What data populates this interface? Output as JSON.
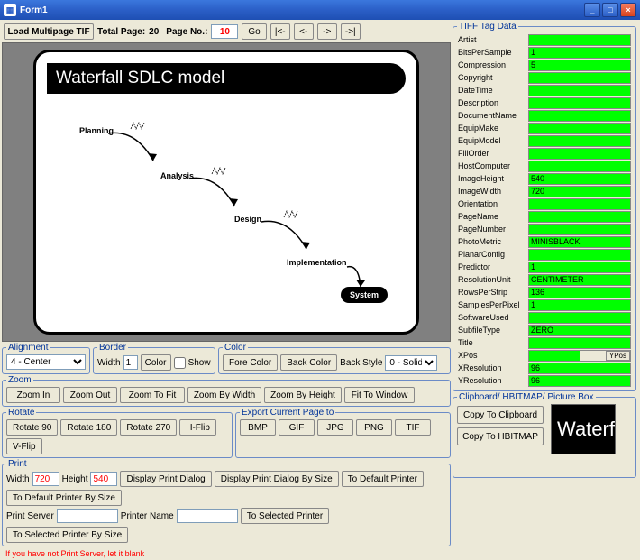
{
  "window": {
    "title": "Form1"
  },
  "toolbar": {
    "loadBtn": "Load Multipage TIF",
    "totalLabel": "Total Page:",
    "totalValue": "20",
    "pageNoLabel": "Page No.:",
    "pageNoValue": "10",
    "goBtn": "Go",
    "first": "|<-",
    "prev": "<-",
    "next": "->",
    "last": "->|"
  },
  "slide": {
    "title": "Waterfall SDLC model",
    "stages": [
      "Planning",
      "Analysis",
      "Design",
      "Implementation"
    ],
    "system": "System"
  },
  "alignment": {
    "legend": "Alignment",
    "value": "4 - Center"
  },
  "border": {
    "legend": "Border",
    "widthLabel": "Width",
    "widthValue": "1",
    "colorBtn": "Color",
    "showLabel": "Show"
  },
  "color": {
    "legend": "Color",
    "foreBtn": "Fore Color",
    "backBtn": "Back Color",
    "styleLabel": "Back Style",
    "styleValue": "0 - Solid"
  },
  "zoom": {
    "legend": "Zoom",
    "in": "Zoom In",
    "out": "Zoom Out",
    "fit": "Zoom To Fit",
    "byW": "Zoom By Width",
    "byH": "Zoom By Height",
    "fitWin": "Fit To Window"
  },
  "rotate": {
    "legend": "Rotate",
    "r90": "Rotate 90",
    "r180": "Rotate 180",
    "r270": "Rotate 270",
    "hflip": "H-Flip",
    "vflip": "V-Flip"
  },
  "export": {
    "legend": "Export Current Page to",
    "bmp": "BMP",
    "gif": "GIF",
    "jpg": "JPG",
    "png": "PNG",
    "tif": "TIF"
  },
  "print": {
    "legend": "Print",
    "widthLabel": "Width",
    "widthValue": "720",
    "heightLabel": "Height",
    "heightValue": "540",
    "dlg": "Display Print Dialog",
    "dlgSize": "Display Print Dialog By Size",
    "toDef": "To Default Printer",
    "toDefSize": "To Default Printer By Size",
    "serverLabel": "Print Server",
    "serverValue": "",
    "nameLabel": "Printer Name",
    "nameValue": "",
    "toSel": "To Selected Printer",
    "toSelSize": "To Selected Printer By Size",
    "warn": "If you have not Print Server, let it blank"
  },
  "tiff": {
    "legend": "TIFF Tag Data",
    "rows": [
      {
        "k": "Artist",
        "v": ""
      },
      {
        "k": "BitsPerSample",
        "v": "1"
      },
      {
        "k": "Compression",
        "v": "5"
      },
      {
        "k": "Copyright",
        "v": ""
      },
      {
        "k": "DateTime",
        "v": ""
      },
      {
        "k": "Description",
        "v": ""
      },
      {
        "k": "DocumentName",
        "v": ""
      },
      {
        "k": "EquipMake",
        "v": ""
      },
      {
        "k": "EquipModel",
        "v": ""
      },
      {
        "k": "FillOrder",
        "v": ""
      },
      {
        "k": "HostComputer",
        "v": ""
      },
      {
        "k": "ImageHeight",
        "v": "540"
      },
      {
        "k": "ImageWidth",
        "v": "720"
      },
      {
        "k": "Orientation",
        "v": ""
      },
      {
        "k": "PageName",
        "v": ""
      },
      {
        "k": "PageNumber",
        "v": ""
      },
      {
        "k": "PhotoMetric",
        "v": "MINISBLACK"
      },
      {
        "k": "PlanarConfig",
        "v": ""
      },
      {
        "k": "Predictor",
        "v": "1"
      },
      {
        "k": "ResolutionUnit",
        "v": "CENTIMETER"
      },
      {
        "k": "RowsPerStrip",
        "v": "136"
      },
      {
        "k": "SamplesPerPixel",
        "v": "1"
      },
      {
        "k": "SoftwareUsed",
        "v": ""
      },
      {
        "k": "SubfileType",
        "v": "ZERO"
      },
      {
        "k": "Title",
        "v": ""
      },
      {
        "k": "XPos",
        "v": "",
        "ypos": "YPos"
      },
      {
        "k": "XResolution",
        "v": "96"
      },
      {
        "k": "YResolution",
        "v": "96"
      }
    ]
  },
  "clipboard": {
    "legend": "Clipboard/ HBITMAP/ Picture Box",
    "copyClip": "Copy To Clipboard",
    "copyHbit": "Copy To HBITMAP",
    "previewText": "Waterf"
  }
}
